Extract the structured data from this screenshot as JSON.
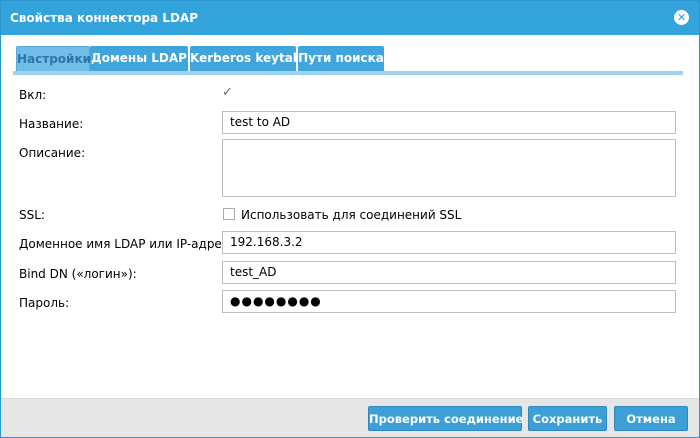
{
  "window": {
    "title": "Свойства коннектора LDAP",
    "close_icon": "close-icon",
    "accent": "#33a3dc"
  },
  "tabs": [
    {
      "label": "Настройки",
      "active": true
    },
    {
      "label": "Домены LDAP",
      "active": false
    },
    {
      "label": "Kerberos keytab",
      "active": false
    },
    {
      "label": "Пути поиска",
      "active": false
    }
  ],
  "form": {
    "enabled": {
      "label": "Вкл:",
      "checked": true
    },
    "name": {
      "label": "Название:",
      "value": "test to AD"
    },
    "description": {
      "label": "Описание:",
      "value": ""
    },
    "ssl": {
      "label": "SSL:",
      "checkbox_text": "Использовать для соединений SSL",
      "checked": false
    },
    "host": {
      "label": "Доменное имя LDAP или IP-адрес:",
      "value": "192.168.3.2"
    },
    "bind_dn": {
      "label": "Bind DN («логин»):",
      "value": "test_AD"
    },
    "password": {
      "label": "Пароль:",
      "value": "●●●●●●●●"
    }
  },
  "footer": {
    "test_label": "Проверить соединение",
    "save_label": "Сохранить",
    "cancel_label": "Отмена"
  }
}
